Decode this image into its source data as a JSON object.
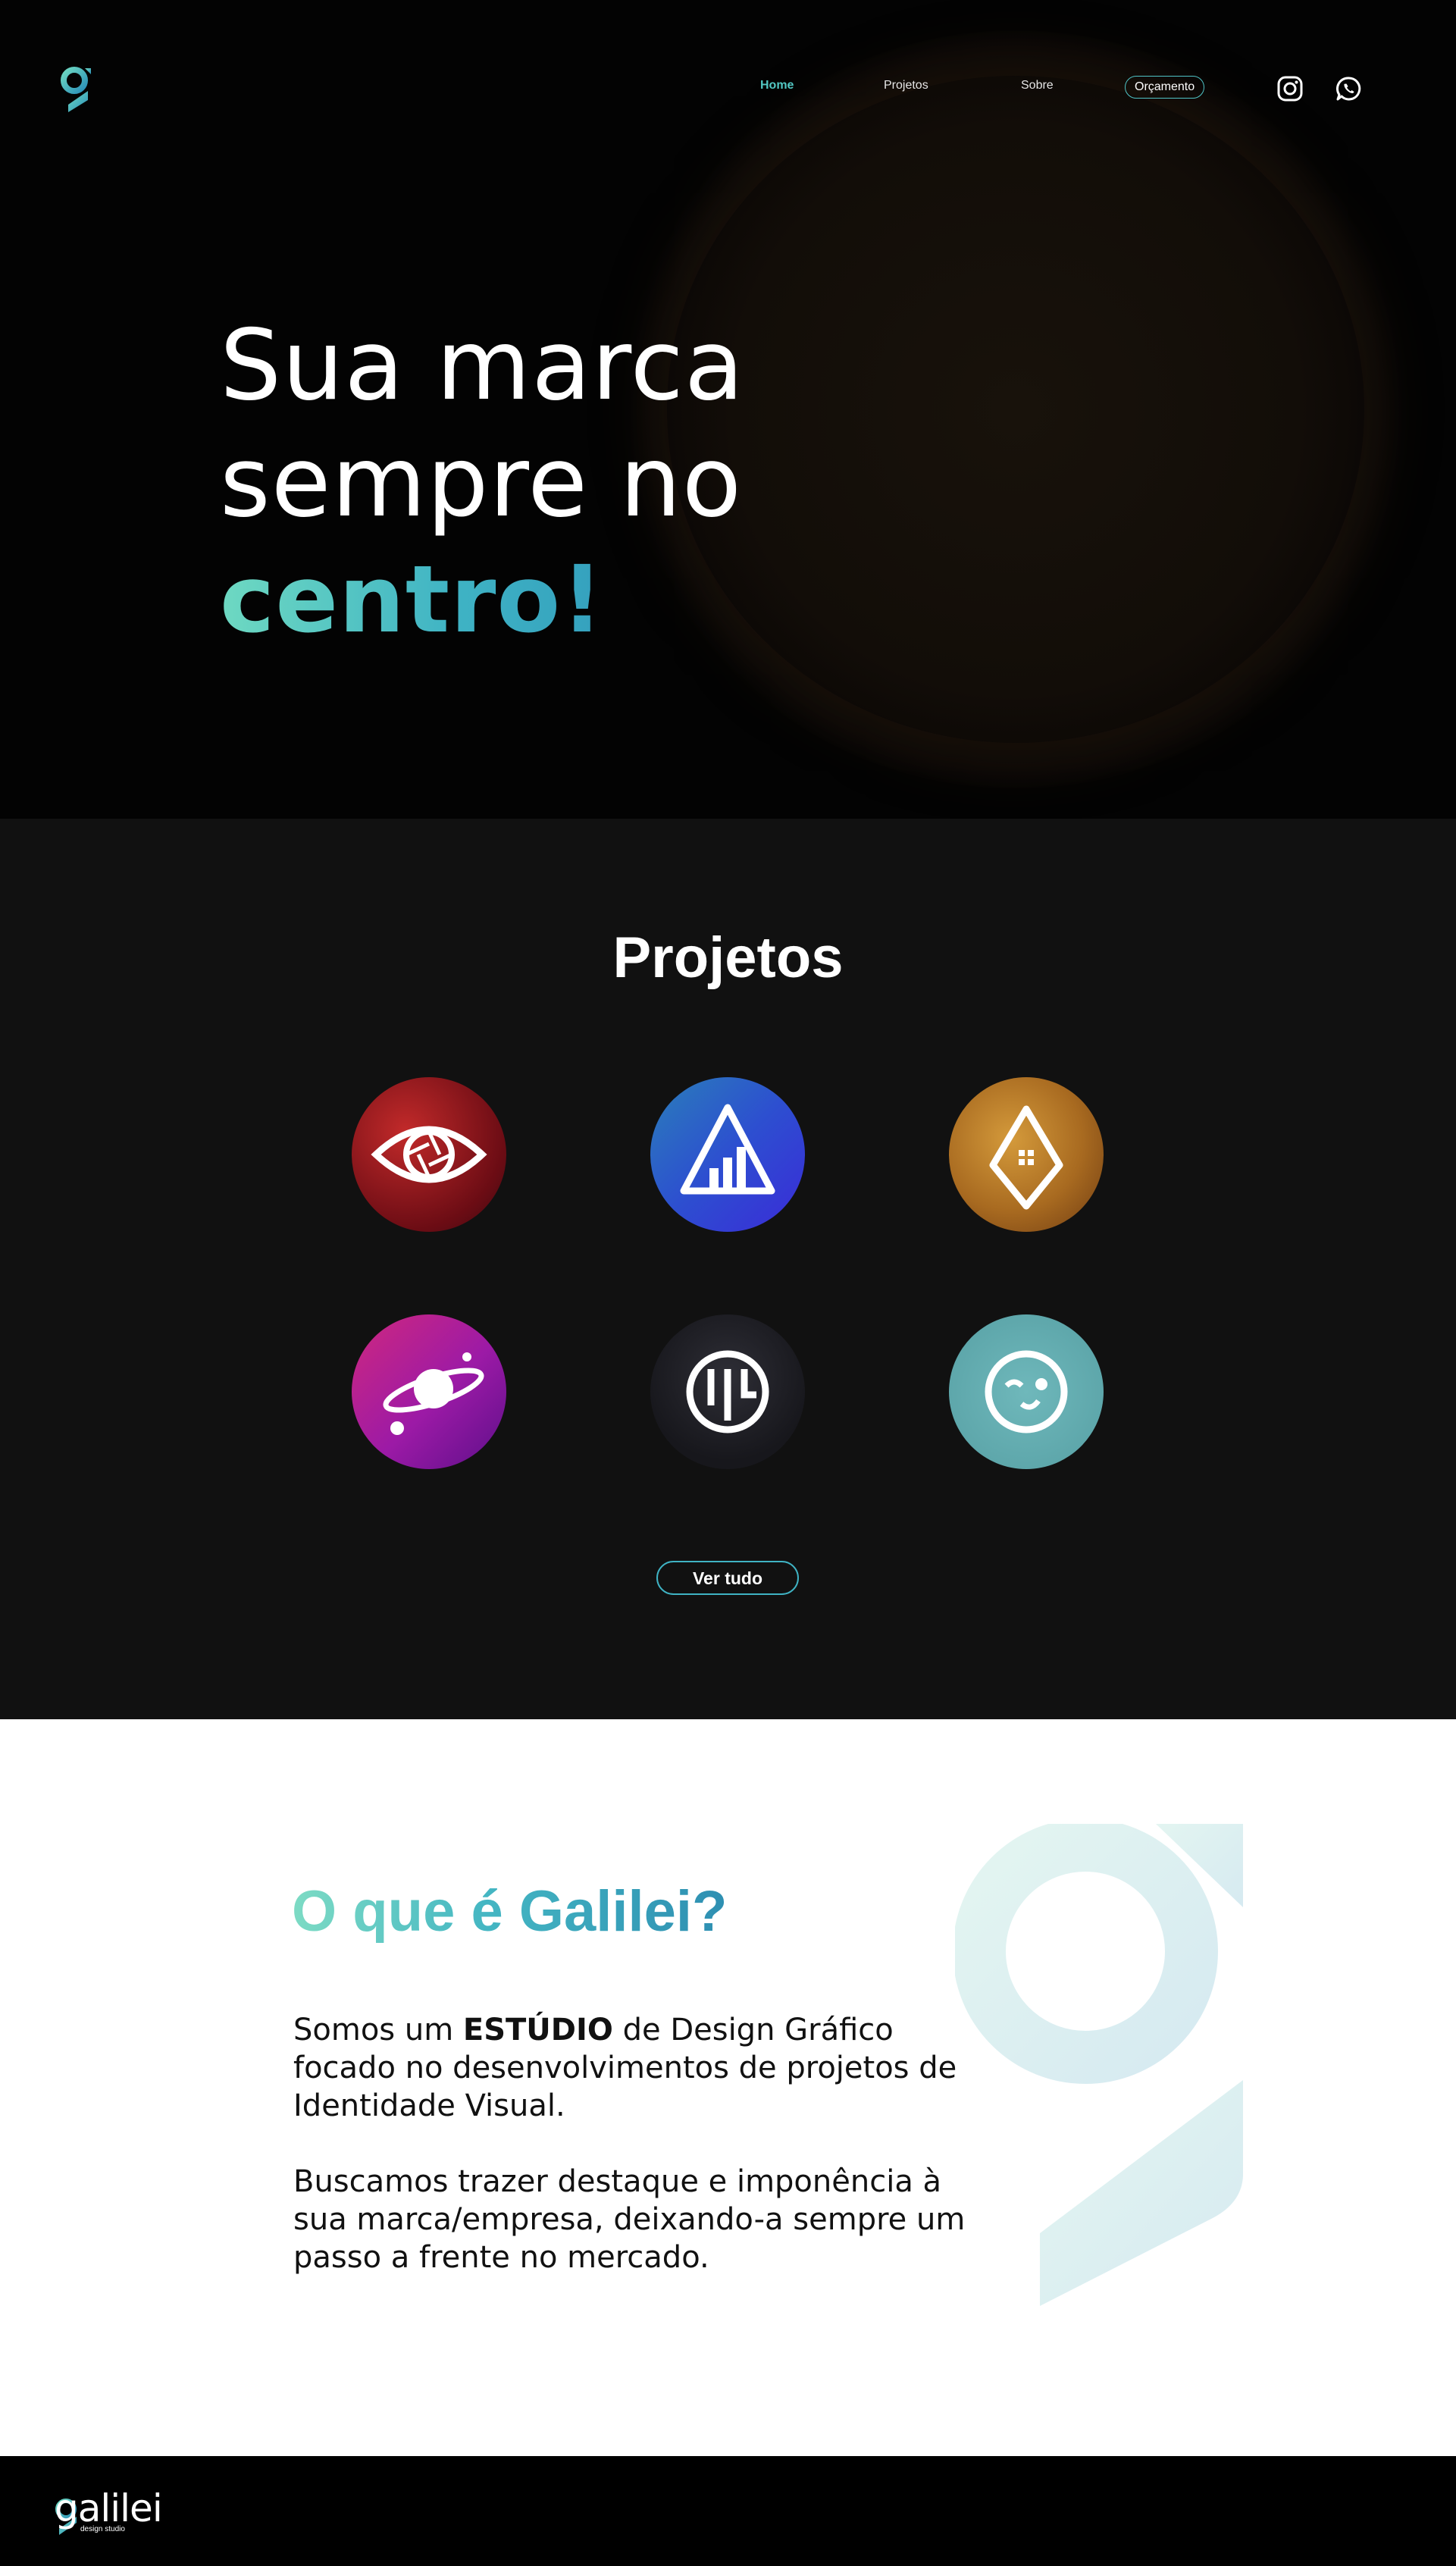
{
  "colors": {
    "accent_teal": "#52c7c3",
    "gradient_start": "#6ed9c2",
    "gradient_end": "#2a8fb8",
    "hero_bg": "#030303",
    "projects_bg": "#111111",
    "about_bg": "#ffffff",
    "footer_bg": "#000000"
  },
  "header": {
    "logo_icon": "galilei-g-logo",
    "nav": {
      "home": "Home",
      "projetos": "Projetos",
      "sobre": "Sobre",
      "orcamento": "Orçamento"
    },
    "social": [
      "instagram-icon",
      "whatsapp-icon"
    ]
  },
  "hero": {
    "line1": "Sua marca",
    "line2": "sempre no",
    "line3": "centro!"
  },
  "projects": {
    "title": "Projetos",
    "items": [
      {
        "icon": "eye-aperture-icon",
        "color": "#a01a22"
      },
      {
        "icon": "triangle-chart-icon",
        "color": "#2d4fd0"
      },
      {
        "icon": "house-pin-icon",
        "color": "#b67426"
      },
      {
        "icon": "planet-icon",
        "color": "#9c1aa6"
      },
      {
        "icon": "wg-monogram-icon",
        "color": "#1c1c22"
      },
      {
        "icon": "winking-face-icon",
        "color": "#5ea7ab"
      }
    ],
    "view_all": "Ver tudo"
  },
  "about": {
    "title": "O que é Galilei?",
    "p1_before": "Somos um ",
    "p1_strong": "ESTÚDIO",
    "p1_after": " de Design Gráfico focado no desenvolvimentos de projetos de Identidade Visual.",
    "p2": "Buscamos trazer destaque e imponência à sua marca/empresa, deixando-a sempre um passo a frente no mercado."
  },
  "footer": {
    "wordmark": "galilei",
    "tagline": "design studio"
  }
}
